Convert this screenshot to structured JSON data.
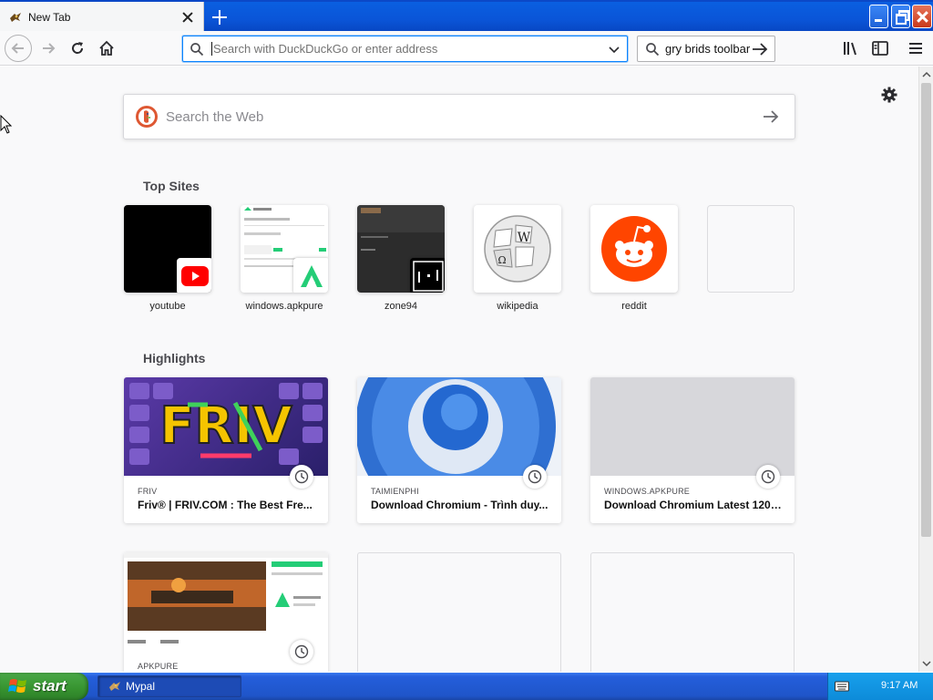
{
  "window": {
    "tab_title": "New Tab",
    "app_name": "Mypal"
  },
  "navbar": {
    "url_placeholder": "Search with DuckDuckGo or enter address",
    "search_value": "gry brids toolbar"
  },
  "newtab": {
    "web_search_placeholder": "Search the Web",
    "top_sites_title": "Top Sites",
    "highlights_title": "Highlights",
    "top_sites": [
      {
        "label": "youtube"
      },
      {
        "label": "windows.apkpure"
      },
      {
        "label": "zone94"
      },
      {
        "label": "wikipedia"
      },
      {
        "label": "reddit"
      }
    ],
    "highlights": [
      {
        "source": "FRIV",
        "title": "Friv® | FRIV.COM : The Best Fre..."
      },
      {
        "source": "TAIMIENPHI",
        "title": "Download Chromium - Trình duy..."
      },
      {
        "source": "WINDOWS.APKPURE",
        "title": "Download Chromium Latest 120...."
      },
      {
        "source": "APKPURE",
        "title": ""
      }
    ]
  },
  "taskbar": {
    "start_label": "start",
    "task_label": "Mypal",
    "clock": "9:17 AM"
  },
  "colors": {
    "accent": "#0a84ff",
    "xp_blue": "#245edb",
    "start_green": "#36932f",
    "reddit_orange": "#ff4500",
    "youtube_red": "#ff0000",
    "apkpure_green": "#24cd77"
  }
}
